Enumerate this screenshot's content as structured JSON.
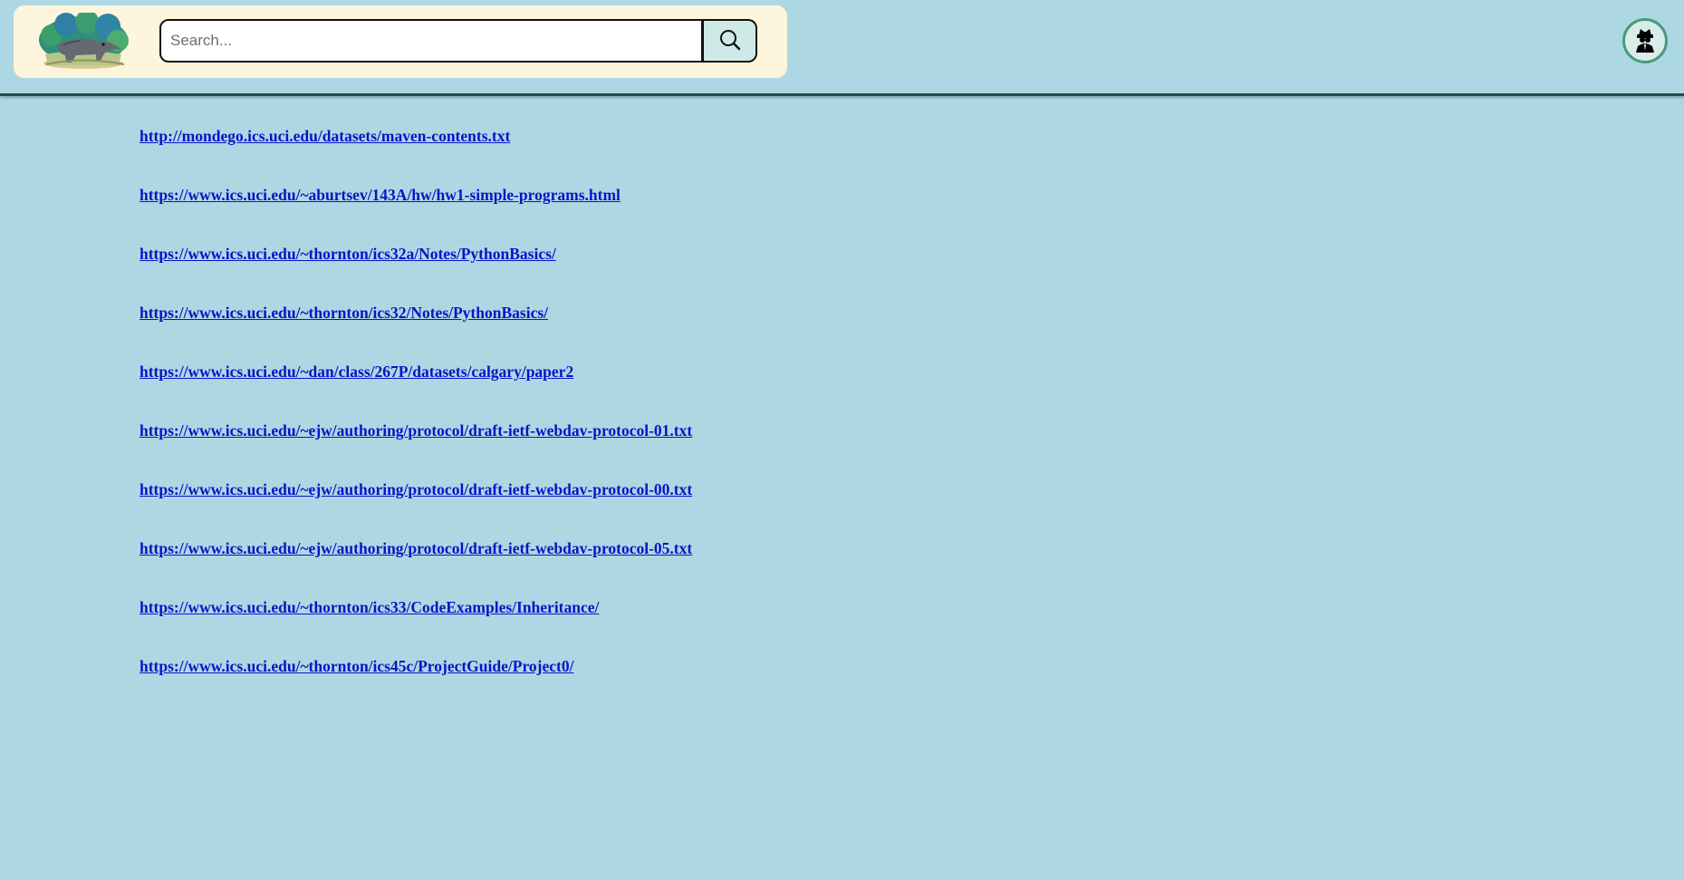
{
  "header": {
    "search": {
      "placeholder": "Search...",
      "value": ""
    },
    "search_button_icon": "search-icon",
    "logo_icon": "anteater-logo",
    "avatar_icon": "spy-icon",
    "accent_colors": {
      "page_background": "#add8e3",
      "panel_background": "#fdf6dc",
      "search_button_background": "#cfe9e6",
      "divider": "#274a47",
      "link": "#0b12c9"
    }
  },
  "results": [
    {
      "url": "http://mondego.ics.uci.edu/datasets/maven-contents.txt"
    },
    {
      "url": "https://www.ics.uci.edu/~aburtsev/143A/hw/hw1-simple-programs.html"
    },
    {
      "url": "https://www.ics.uci.edu/~thornton/ics32a/Notes/PythonBasics/"
    },
    {
      "url": "https://www.ics.uci.edu/~thornton/ics32/Notes/PythonBasics/"
    },
    {
      "url": "https://www.ics.uci.edu/~dan/class/267P/datasets/calgary/paper2"
    },
    {
      "url": "https://www.ics.uci.edu/~ejw/authoring/protocol/draft-ietf-webdav-protocol-01.txt"
    },
    {
      "url": "https://www.ics.uci.edu/~ejw/authoring/protocol/draft-ietf-webdav-protocol-00.txt"
    },
    {
      "url": "https://www.ics.uci.edu/~ejw/authoring/protocol/draft-ietf-webdav-protocol-05.txt"
    },
    {
      "url": "https://www.ics.uci.edu/~thornton/ics33/CodeExamples/Inheritance/"
    },
    {
      "url": "https://www.ics.uci.edu/~thornton/ics45c/ProjectGuide/Project0/"
    }
  ]
}
